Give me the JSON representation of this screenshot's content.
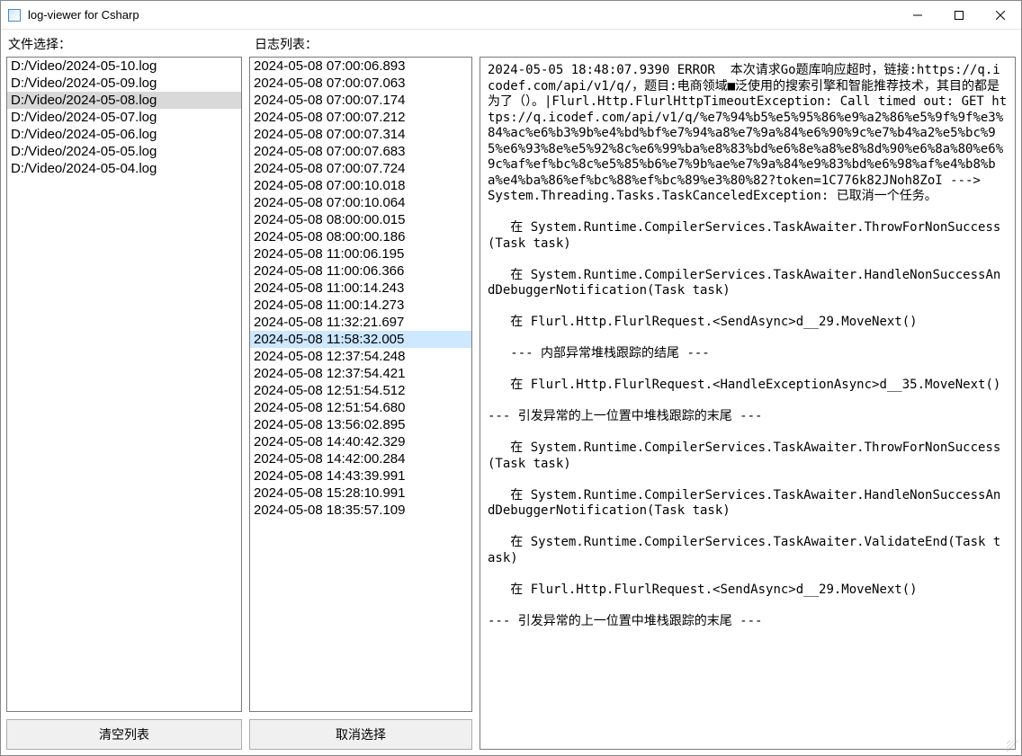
{
  "window": {
    "title": "log-viewer for Csharp"
  },
  "labels": {
    "file_select": "文件选择：",
    "log_list": "日志列表：",
    "clear_list": "清空列表",
    "cancel_select": "取消选择"
  },
  "files": {
    "selected_index": 2,
    "items": [
      "D:/Video/2024-05-10.log",
      "D:/Video/2024-05-09.log",
      "D:/Video/2024-05-08.log",
      "D:/Video/2024-05-07.log",
      "D:/Video/2024-05-06.log",
      "D:/Video/2024-05-05.log",
      "D:/Video/2024-05-04.log"
    ]
  },
  "timestamps": {
    "selected_index": 16,
    "items": [
      "2024-05-08 07:00:06.893",
      "2024-05-08 07:00:07.063",
      "2024-05-08 07:00:07.174",
      "2024-05-08 07:00:07.212",
      "2024-05-08 07:00:07.314",
      "2024-05-08 07:00:07.683",
      "2024-05-08 07:00:07.724",
      "2024-05-08 07:00:10.018",
      "2024-05-08 07:00:10.064",
      "2024-05-08 08:00:00.015",
      "2024-05-08 08:00:00.186",
      "2024-05-08 11:00:06.195",
      "2024-05-08 11:00:06.366",
      "2024-05-08 11:00:14.243",
      "2024-05-08 11:00:14.273",
      "2024-05-08 11:32:21.697",
      "2024-05-08 11:58:32.005",
      "2024-05-08 12:37:54.248",
      "2024-05-08 12:37:54.421",
      "2024-05-08 12:51:54.512",
      "2024-05-08 12:51:54.680",
      "2024-05-08 13:56:02.895",
      "2024-05-08 14:40:42.329",
      "2024-05-08 14:42:00.284",
      "2024-05-08 14:43:39.991",
      "2024-05-08 15:28:10.991",
      "2024-05-08 18:35:57.109"
    ]
  },
  "detail": {
    "text": "2024-05-05 18:48:07.9390 ERROR  本次请求Go题库响应超时，链接:https://q.icodef.com/api/v1/q/，题目:电商领域■泛使用的搜索引擎和智能推荐技术，其目的都是为了（）。|Flurl.Http.FlurlHttpTimeoutException: Call timed out: GET https://q.icodef.com/api/v1/q/%e7%94%b5%e5%95%86%e9%a2%86%e5%9f%9f%e3%84%ac%e6%b3%9b%e4%bd%bf%e7%94%a8%e7%9a%84%e6%90%9c%e7%b4%a2%e5%bc%95%e6%93%8e%e5%92%8c%e6%99%ba%e8%83%bd%e6%8e%a8%e8%8d%90%e6%8a%80%e6%9c%af%ef%bc%8c%e5%85%b6%e7%9b%ae%e7%9a%84%e9%83%bd%e6%98%af%e4%b8%ba%e4%ba%86%ef%bc%88%ef%bc%89%e3%80%82?token=1C776k82JNoh8ZoI --->\nSystem.Threading.Tasks.TaskCanceledException: 已取消一个任务。\n\n   在 System.Runtime.CompilerServices.TaskAwaiter.ThrowForNonSuccess(Task task)\n\n   在 System.Runtime.CompilerServices.TaskAwaiter.HandleNonSuccessAndDebuggerNotification(Task task)\n\n   在 Flurl.Http.FlurlRequest.<SendAsync>d__29.MoveNext()\n\n   --- 内部异常堆栈跟踪的结尾 ---\n\n   在 Flurl.Http.FlurlRequest.<HandleExceptionAsync>d__35.MoveNext()\n\n--- 引发异常的上一位置中堆栈跟踪的末尾 ---\n\n   在 System.Runtime.CompilerServices.TaskAwaiter.ThrowForNonSuccess(Task task)\n\n   在 System.Runtime.CompilerServices.TaskAwaiter.HandleNonSuccessAndDebuggerNotification(Task task)\n\n   在 System.Runtime.CompilerServices.TaskAwaiter.ValidateEnd(Task task)\n\n   在 Flurl.Http.FlurlRequest.<SendAsync>d__29.MoveNext()\n\n--- 引发异常的上一位置中堆栈跟踪的末尾 ---"
  }
}
